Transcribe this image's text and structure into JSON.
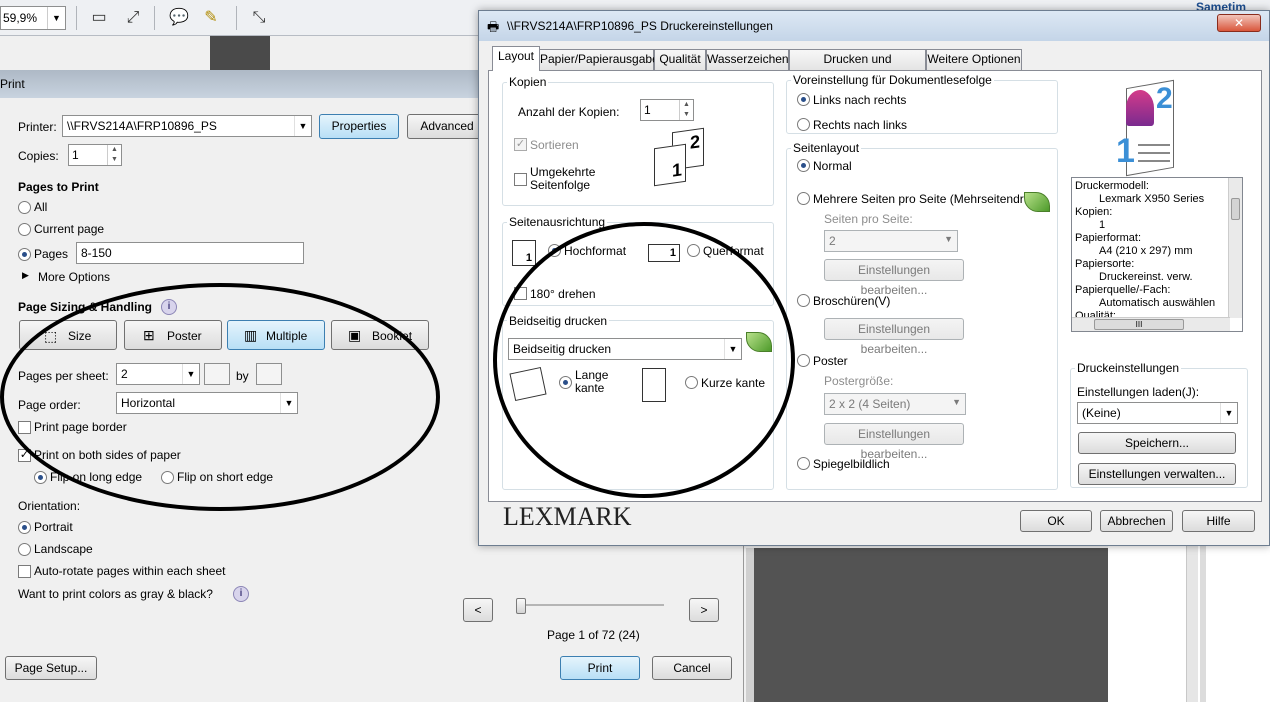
{
  "toolbar": {
    "zoom": "59,9%"
  },
  "sametime": "Sametim",
  "print": {
    "title": "Print",
    "printer_label": "Printer:",
    "printer_value": "\\\\FRVS214A\\FRP10896_PS",
    "properties_btn": "Properties",
    "advanced_btn": "Advanced",
    "copies_label": "Copies:",
    "copies_value": "1",
    "pages_to_print": "Pages to Print",
    "all": "All",
    "current_page": "Current page",
    "pages": "Pages",
    "pages_value": "8-150",
    "more_options": "More Options",
    "sizing_title": "Page Sizing & Handling",
    "size_btn": "Size",
    "poster_btn": "Poster",
    "multiple_btn": "Multiple",
    "booklet_btn": "Booklet",
    "pages_per_sheet_label": "Pages per sheet:",
    "pages_per_sheet_value": "2",
    "by": "by",
    "page_order_label": "Page order:",
    "page_order_value": "Horizontal",
    "print_page_border": "Print page border",
    "both_sides": "Print on both sides of paper",
    "flip_long": "Flip on long edge",
    "flip_short": "Flip on short edge",
    "orientation": "Orientation:",
    "portrait": "Portrait",
    "landscape": "Landscape",
    "auto_rotate": "Auto-rotate pages within each sheet",
    "gray_question": "Want to print colors as gray & black?",
    "page_info": "Page 1 of 72 (24)",
    "page_setup_btn": "Page Setup...",
    "print_btn": "Print",
    "cancel_btn": "Cancel",
    "prev": "<",
    "next": ">"
  },
  "lex": {
    "title": "\\\\FRVS214A\\FRP10896_PS Druckereinstellungen",
    "tabs": [
      "Layout",
      "Papier/Papierausgabe",
      "Qualität",
      "Wasserzeichen",
      "Drucken und Zurückhalten",
      "Weitere Optionen"
    ],
    "kopien": "Kopien",
    "anzahl": "Anzahl der Kopien:",
    "anzahl_value": "1",
    "sortieren": "Sortieren",
    "umgekehrt_1": "Umgekehrte",
    "umgekehrt_2": "Seitenfolge",
    "ausrichtung": "Seitenausrichtung",
    "hochformat": "Hochformat",
    "querformat": "Querformat",
    "drehen": "180° drehen",
    "beidseitig": "Beidseitig drucken",
    "beidseitig_value": "Beidseitig drucken",
    "lange_1": "Lange",
    "lange_2": "kante",
    "kurze": "Kurze kante",
    "voreinstellung": "Voreinstellung für Dokumentlesefolge",
    "links_rechts": "Links nach rechts",
    "rechts_links": "Rechts nach links",
    "seitenlayout": "Seitenlayout",
    "normal": "Normal",
    "mehrere": "Mehrere Seiten pro Seite (Mehrseitendruck)",
    "seiten_pro_seite": "Seiten pro Seite:",
    "seiten_value": "2",
    "einstellungen_bearbeiten": "Einstellungen bearbeiten...",
    "broschueren": "Broschüren(V)",
    "poster": "Poster",
    "postergroesse": "Postergröße:",
    "poster_value": "2 x 2 (4 Seiten)",
    "spiegelbildlich": "Spiegelbildlich",
    "info": [
      "Druckermodell:",
      "Lexmark X950 Series",
      "Kopien:",
      "1",
      "Papierformat:",
      "A4 (210 x 297) mm",
      "Papiersorte:",
      "Druckereinst. verw.",
      "Papierquelle/-Fach:",
      "Automatisch auswählen",
      "Qualität:"
    ],
    "druckeinstellungen": "Druckeinstellungen",
    "laden": "Einstellungen laden(J):",
    "laden_value": "(Keine)",
    "speichern": "Speichern...",
    "verwalten": "Einstellungen verwalten...",
    "logo": "LEXMARK",
    "ok": "OK",
    "abbrechen": "Abbrechen",
    "hilfe": "Hilfe",
    "preview_num": "2",
    "preview_num2": "1",
    "icon_num": "1",
    "icon_num2": "2",
    "scroll": "III"
  }
}
